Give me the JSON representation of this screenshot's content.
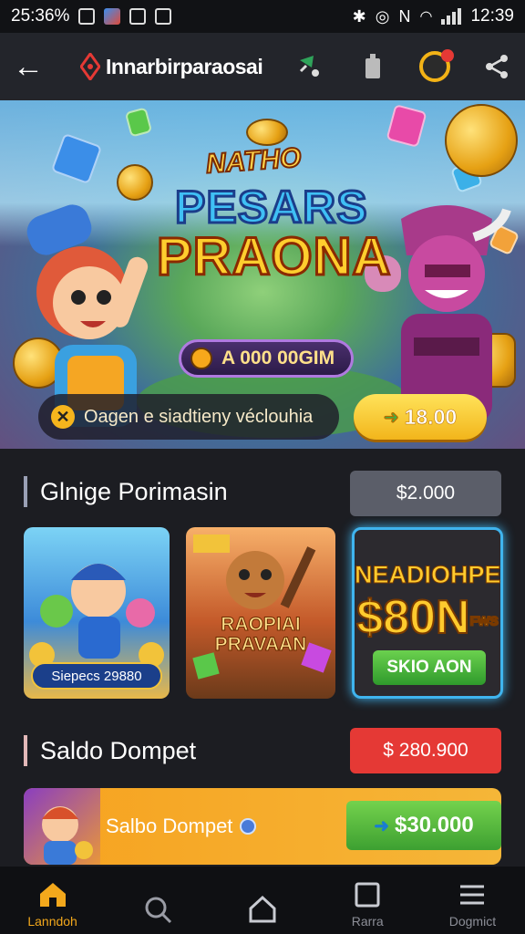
{
  "status_bar": {
    "time_left": "25:36%",
    "time_right": "12:39"
  },
  "app_bar": {
    "title": "Innarbirparaosai"
  },
  "hero": {
    "title_line1": "NATHO",
    "title_line2": "PESARS",
    "title_line3": "PRAONA",
    "jackpot": "A 000 00GIM",
    "promo_text": "Oagen e siadtieny véclouhia",
    "cta_amount": "18.00"
  },
  "section_promo": {
    "title": "Glnige Porimasin",
    "amount": "$2.000",
    "cards": [
      {
        "label": "Siepecs 29880"
      },
      {
        "label_line1": "RAOPIAI",
        "label_line2": "PRAVAAN"
      },
      {
        "label_line1": "NEADIOHPET",
        "label_line2": "$80N",
        "badge": "FWS",
        "button": "SKIO AON"
      }
    ]
  },
  "section_wallet": {
    "title": "Saldo Dompet",
    "amount": "$ 280.900",
    "row_label": "Salbo Dompet",
    "row_button": "$30.000"
  },
  "bottom_nav": [
    {
      "label": "Lanndoh",
      "icon": "home-icon",
      "active": true
    },
    {
      "label": "",
      "icon": "search-icon",
      "active": false
    },
    {
      "label": "",
      "icon": "house-outline-icon",
      "active": false
    },
    {
      "label": "Rarra",
      "icon": "square-icon",
      "active": false
    },
    {
      "label": "Dogmict",
      "icon": "menu-icon",
      "active": false
    }
  ],
  "colors": {
    "accent": "#f3a81c",
    "promo_badge": "#5b5e69",
    "wallet_badge": "#e53935",
    "card_glow": "#3fb4ee"
  }
}
